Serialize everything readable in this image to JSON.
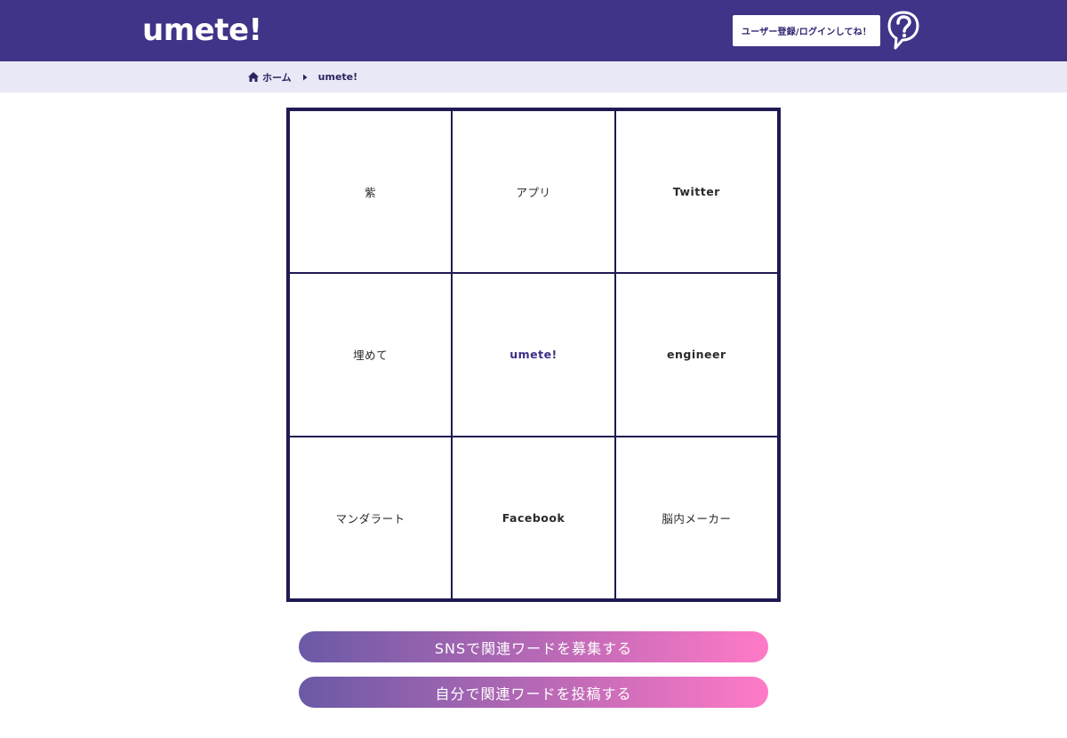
{
  "header": {
    "logo": "umete!",
    "login_label": "ユーザー登録/ログインしてね！",
    "help_icon": "question-bubble-icon",
    "bg_color": "#3f3488"
  },
  "breadcrumb": {
    "home_icon": "home-icon",
    "home_label": "ホーム",
    "separator_icon": "caret-right-icon",
    "current": "umete!",
    "bg_color": "#e9e8f6"
  },
  "mandala": {
    "cells": [
      "紫",
      "アプリ",
      "Twitter",
      "埋めて",
      "umete!",
      "engineer",
      "マンダラート",
      "Facebook",
      "脳内メーカー"
    ],
    "border_color": "#1e1a52"
  },
  "actions": {
    "sns_label": "SNSで関連ワードを募集する",
    "post_label": "自分で関連ワードを投稿する",
    "gradient_start": "#6a5aa6",
    "gradient_end": "#ff7ac7"
  }
}
